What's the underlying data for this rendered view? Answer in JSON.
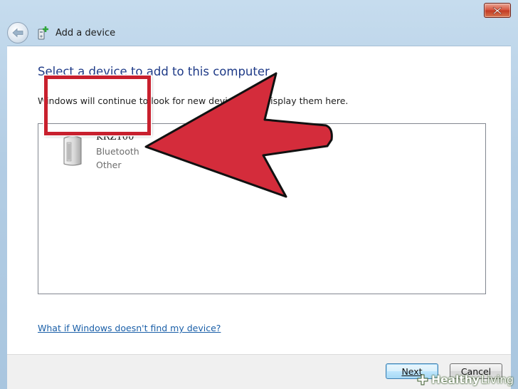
{
  "window": {
    "title": "Add a device"
  },
  "wizard": {
    "heading": "Select a device to add to this computer",
    "instruction": "Windows will continue to look for new devices and display them here.",
    "help_link": "What if Windows doesn't find my device?"
  },
  "devices": [
    {
      "name": "KRZ100",
      "type": "Bluetooth",
      "category": "Other",
      "icon": "speaker-device-icon"
    }
  ],
  "buttons": {
    "next": "Next",
    "cancel": "Cancel"
  },
  "watermark": {
    "bold": "Healthy",
    "light": "Living"
  },
  "colors": {
    "heading": "#1e3a87",
    "link": "#1a5fa8",
    "annotation_red": "#d22a3a",
    "close_button": "#c94a33"
  }
}
